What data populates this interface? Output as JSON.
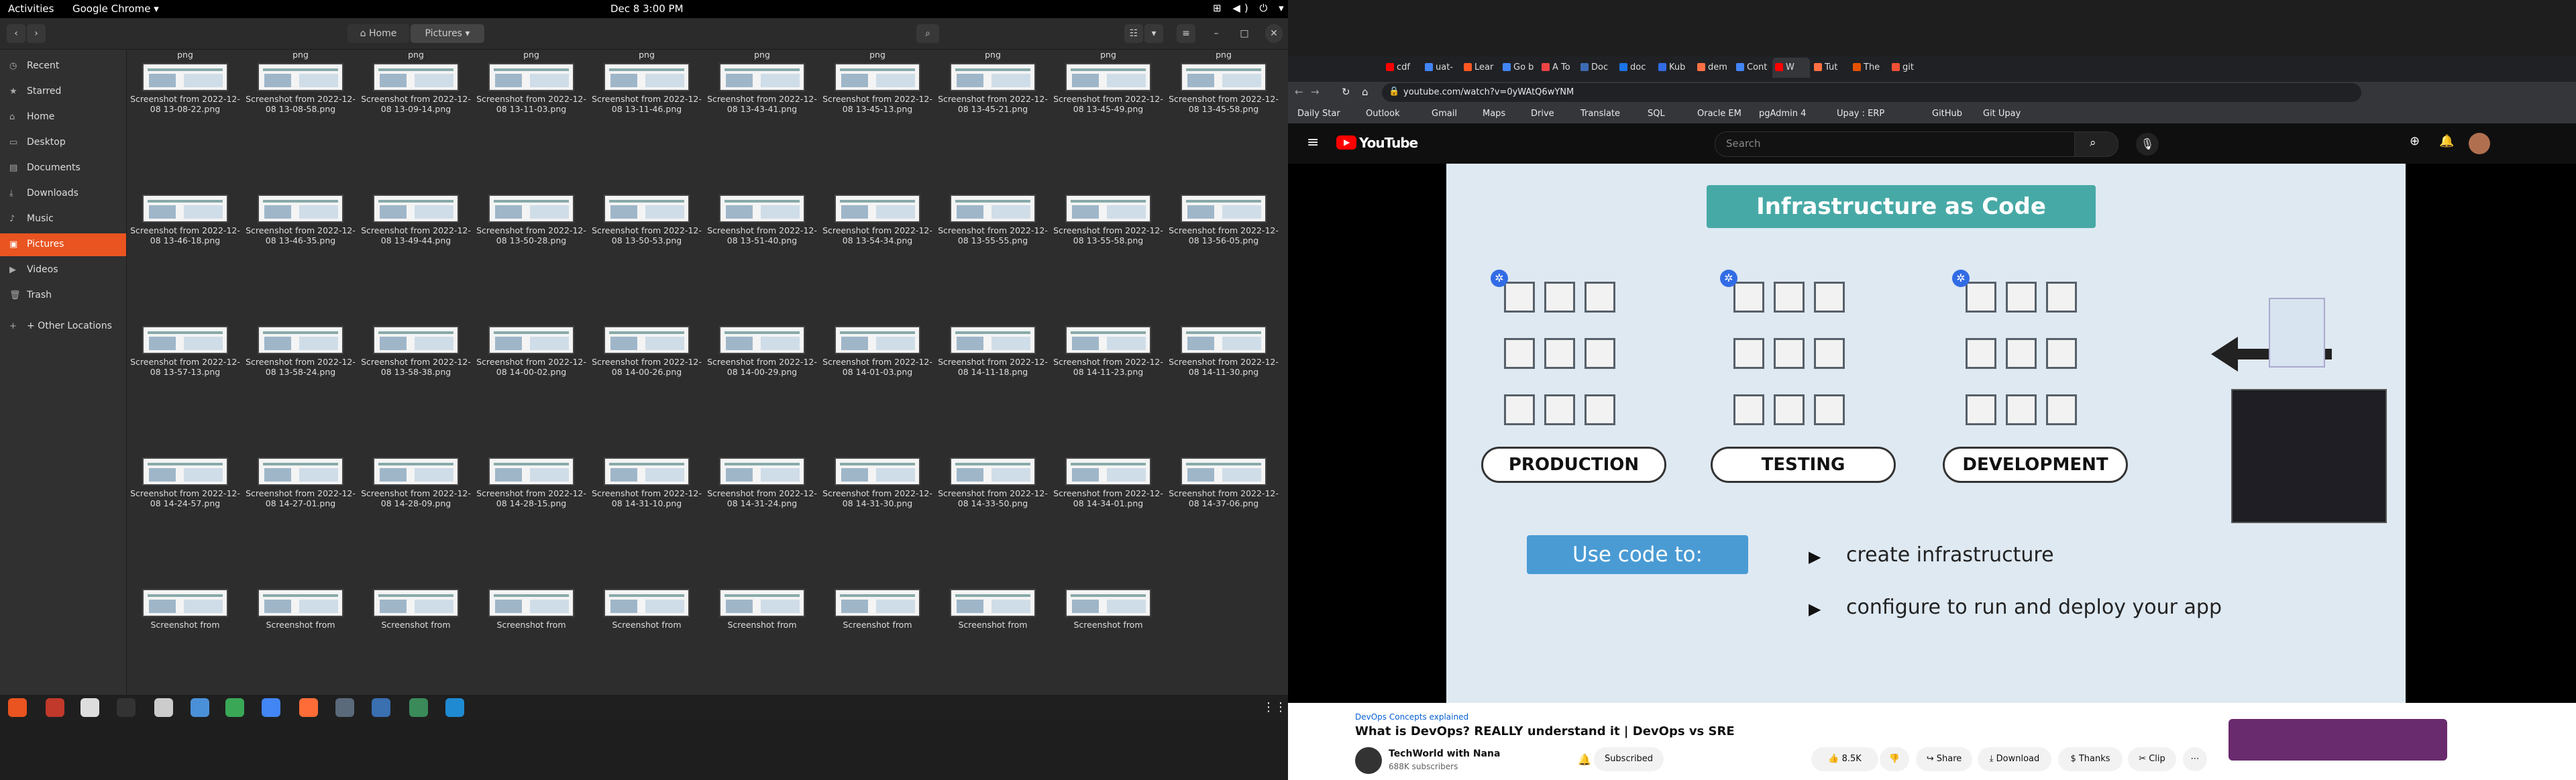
{
  "topbar": {
    "activities": "Activities",
    "app_menu": "Google Chrome ▾",
    "clock": "Dec 8  3:00 PM",
    "sys_icons": "⊞ ◀) ⏻ ▾"
  },
  "files": {
    "breadcrumb": {
      "home": "Home",
      "current": "Pictures"
    },
    "sidebar": [
      {
        "label": "Recent",
        "icon": "clock-icon",
        "glyph": "◷"
      },
      {
        "label": "Starred",
        "icon": "star-icon",
        "glyph": "★"
      },
      {
        "label": "Home",
        "icon": "home-icon",
        "glyph": "⌂"
      },
      {
        "label": "Desktop",
        "icon": "desktop-icon",
        "glyph": "▭"
      },
      {
        "label": "Documents",
        "icon": "document-icon",
        "glyph": "▤"
      },
      {
        "label": "Downloads",
        "icon": "download-icon",
        "glyph": "⤓"
      },
      {
        "label": "Music",
        "icon": "music-icon",
        "glyph": "♪"
      },
      {
        "label": "Pictures",
        "icon": "pictures-icon",
        "glyph": "▣"
      },
      {
        "label": "Videos",
        "icon": "video-icon",
        "glyph": "▶"
      },
      {
        "label": "Trash",
        "icon": "trash-icon",
        "glyph": "🗑"
      },
      {
        "label": "+ Other Locations",
        "icon": "other-locations-icon",
        "glyph": "+"
      }
    ],
    "top_row_tail": "png",
    "rows": [
      [
        "Screenshot from 2022-12-08 13-08-22.png",
        "Screenshot from 2022-12-08 13-08-58.png",
        "Screenshot from 2022-12-08 13-09-14.png",
        "Screenshot from 2022-12-08 13-11-03.png",
        "Screenshot from 2022-12-08 13-11-46.png",
        "Screenshot from 2022-12-08 13-43-41.png",
        "Screenshot from 2022-12-08 13-45-13.png",
        "Screenshot from 2022-12-08 13-45-21.png",
        "Screenshot from 2022-12-08 13-45-49.png",
        "Screenshot from 2022-12-08 13-45-58.png"
      ],
      [
        "Screenshot from 2022-12-08 13-46-18.png",
        "Screenshot from 2022-12-08 13-46-35.png",
        "Screenshot from 2022-12-08 13-49-44.png",
        "Screenshot from 2022-12-08 13-50-28.png",
        "Screenshot from 2022-12-08 13-50-53.png",
        "Screenshot from 2022-12-08 13-51-40.png",
        "Screenshot from 2022-12-08 13-54-34.png",
        "Screenshot from 2022-12-08 13-55-55.png",
        "Screenshot from 2022-12-08 13-55-58.png",
        "Screenshot from 2022-12-08 13-56-05.png"
      ],
      [
        "Screenshot from 2022-12-08 13-57-13.png",
        "Screenshot from 2022-12-08 13-58-24.png",
        "Screenshot from 2022-12-08 13-58-38.png",
        "Screenshot from 2022-12-08 14-00-02.png",
        "Screenshot from 2022-12-08 14-00-26.png",
        "Screenshot from 2022-12-08 14-00-29.png",
        "Screenshot from 2022-12-08 14-01-03.png",
        "Screenshot from 2022-12-08 14-11-18.png",
        "Screenshot from 2022-12-08 14-11-23.png",
        "Screenshot from 2022-12-08 14-11-30.png"
      ],
      [
        "Screenshot from 2022-12-08 14-24-57.png",
        "Screenshot from 2022-12-08 14-27-01.png",
        "Screenshot from 2022-12-08 14-28-09.png",
        "Screenshot from 2022-12-08 14-28-15.png",
        "Screenshot from 2022-12-08 14-31-10.png",
        "Screenshot from 2022-12-08 14-31-24.png",
        "Screenshot from 2022-12-08 14-31-30.png",
        "Screenshot from 2022-12-08 14-33-50.png",
        "Screenshot from 2022-12-08 14-34-01.png",
        "Screenshot from 2022-12-08 14-37-06.png"
      ],
      [
        "Screenshot from",
        "Screenshot from",
        "Screenshot from",
        "Screenshot from",
        "Screenshot from",
        "Screenshot from",
        "Screenshot from",
        "Screenshot from",
        "Screenshot from"
      ]
    ]
  },
  "chrome": {
    "tabs": [
      "cdf",
      "uat-",
      "Lear",
      "Go b",
      "A To",
      "Doc",
      "doc",
      "Kub",
      "dem",
      "Cont",
      "W",
      "Tut",
      "The",
      "git"
    ],
    "url": "youtube.com/watch?v=0yWAtQ6wYNM",
    "bookmarks": [
      "Daily Star",
      "Outlook",
      "Gmail",
      "Maps",
      "Drive",
      "Translate",
      "SQL",
      "Oracle EM",
      "pgAdmin 4",
      "Upay : ERP",
      "GitHub",
      "Git Upay"
    ]
  },
  "youtube": {
    "logo": "YouTube",
    "search_placeholder": "Search",
    "video": {
      "slide_title": "Infrastructure as Code",
      "env_labels": [
        "PRODUCTION",
        "TESTING",
        "DEVELOPMENT"
      ],
      "use_code": "Use code to:",
      "bullets": [
        "create infrastructure",
        "configure to run and deploy your app"
      ]
    },
    "playlist_label": "DevOps Concepts explained",
    "title": "What is DevOps? REALLY understand it | DevOps vs SRE",
    "channel": "TechWorld with Nana",
    "subscribers": "688K subscribers",
    "subscribed": "Subscribed",
    "likes": "8.5K",
    "share": "Share",
    "download": "Download",
    "thanks": "Thanks",
    "clip": "Clip"
  },
  "colors": {
    "accent": "#e95420",
    "yt_red": "#ff0000",
    "slide_teal": "#47a9a6",
    "code_btn": "#4a9bd4"
  }
}
